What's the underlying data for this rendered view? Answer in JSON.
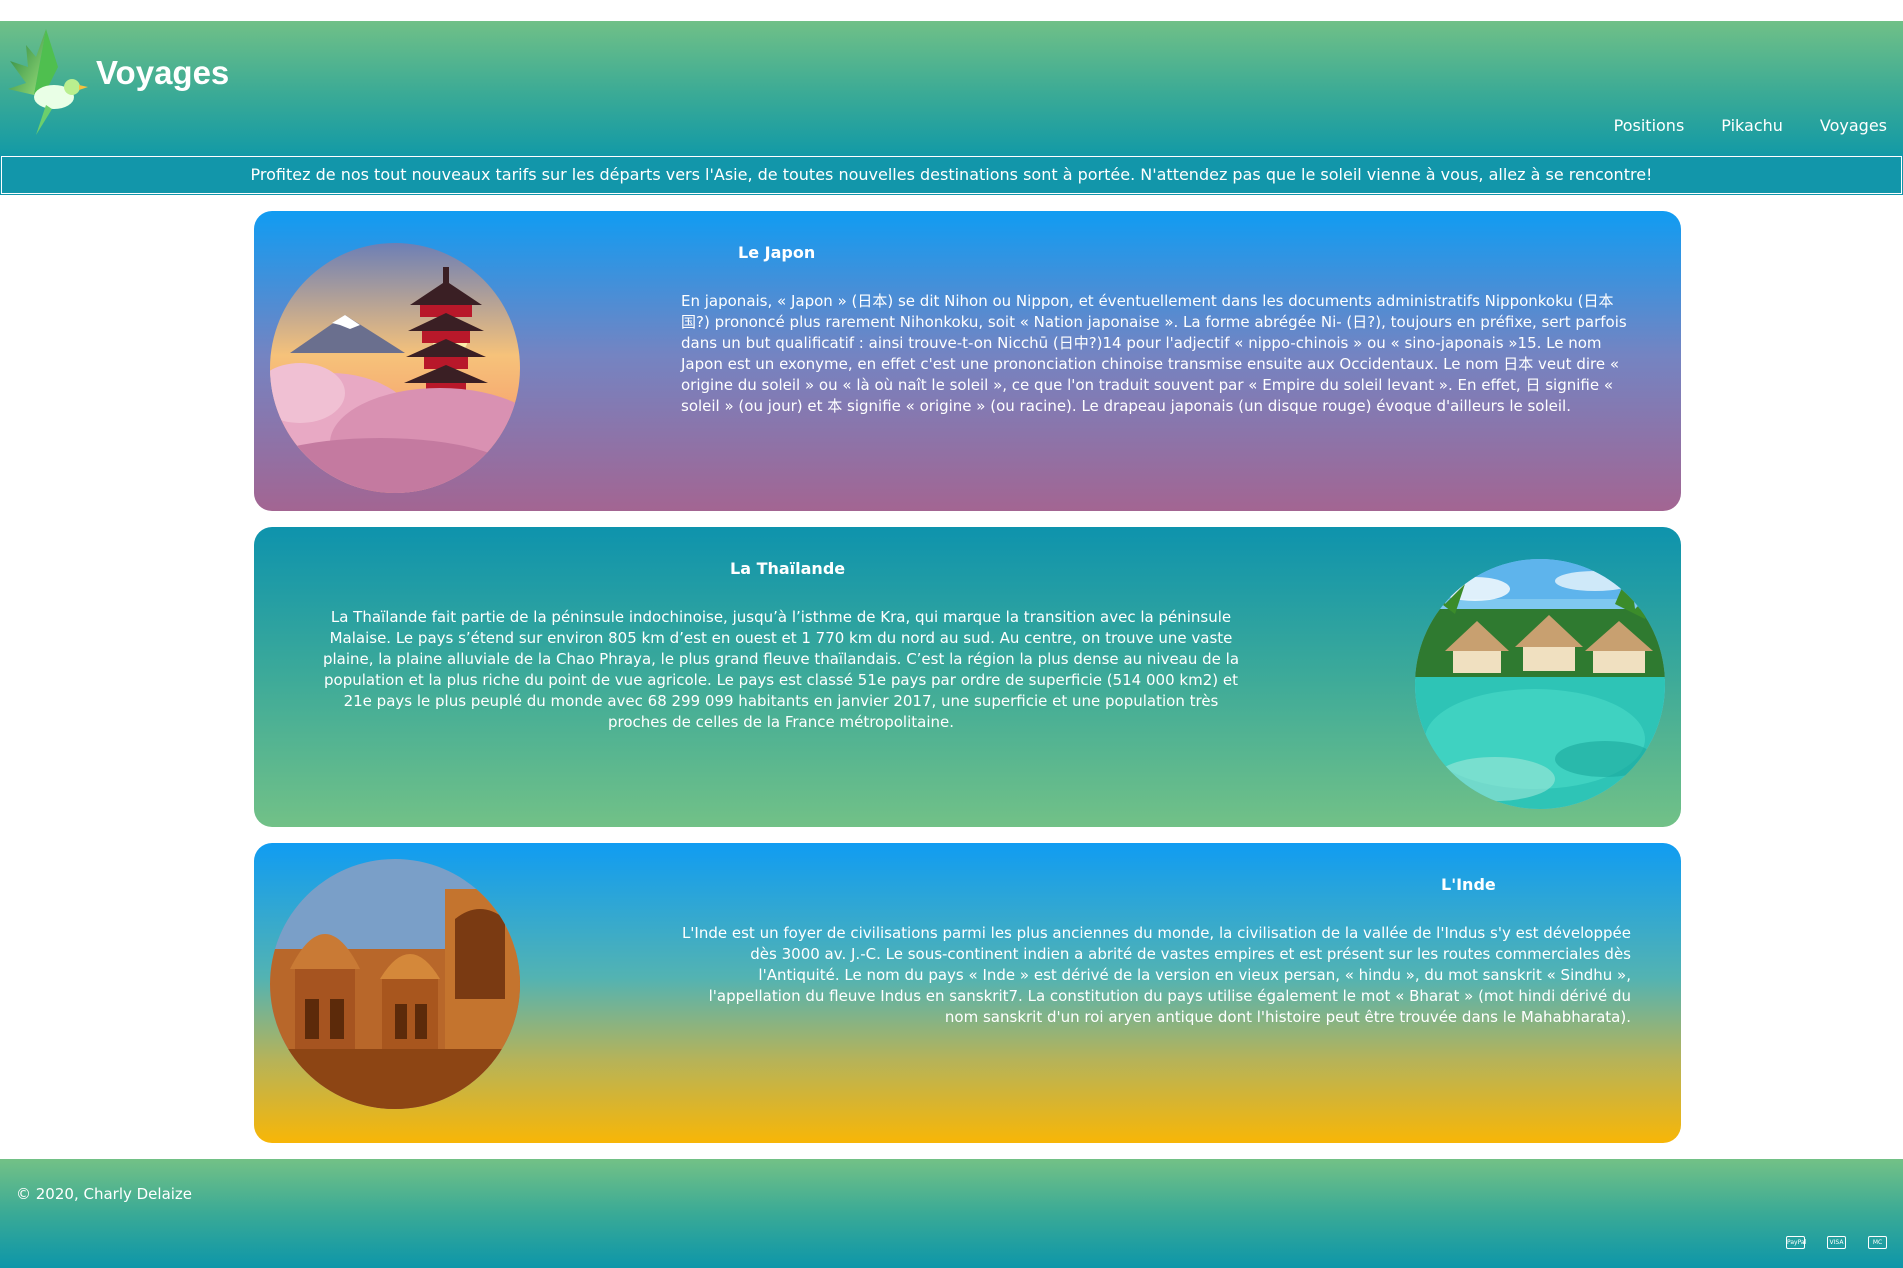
{
  "header": {
    "brand": "Voyages",
    "nav": [
      "Positions",
      "Pikachu",
      "Voyages"
    ]
  },
  "banner": "Profitez de nos tout nouveaux tarifs sur les départs vers l'Asie, de toutes nouvelles destinations sont à portée. N'attendez pas que le soleil vienne à vous, allez à se rencontre!",
  "cards": [
    {
      "title": "Le Japon",
      "text": "En japonais, « Japon » (日本) se dit Nihon ou Nippon, et éventuellement dans les documents administratifs Nipponkoku (日本国?) prononcé plus rarement Nihonkoku, soit « Nation japonaise ». La forme abrégée Ni- (日?), toujours en préfixe, sert parfois dans un but qualificatif : ainsi trouve-t-on Nicchū (日中?)14 pour l'adjectif « nippo-chinois » ou « sino-japonais »15. Le nom Japon est un exonyme, en effet c'est une prononciation chinoise transmise ensuite aux Occidentaux. Le nom 日本 veut dire « origine du soleil » ou « là où naît le soleil », ce que l'on traduit souvent par « Empire du soleil levant ». En effet, 日 signifie « soleil » (ou jour) et 本 signifie « origine » (ou racine). Le drapeau japonais (un disque rouge) évoque d'ailleurs le soleil.",
      "colors": [
        "#109cf2",
        "#a36592"
      ]
    },
    {
      "title": "La Thaïlande",
      "text": "La Thaïlande fait partie de la péninsule indochinoise, jusqu’à l’isthme de Kra, qui marque la transition avec la péninsule Malaise. Le pays s’étend sur environ 805 km d’est en ouest et 1 770 km du nord au sud. Au centre, on trouve une vaste plaine, la plaine alluviale de la Chao Phraya, le plus grand fleuve thaïlandais. C’est la région la plus dense au niveau de la population et la plus riche du point de vue agricole. Le pays est classé 51e pays par ordre de superficie (514 000 km2) et 21e pays le plus peuplé du monde avec 68 299 099 habitants en janvier 2017, une superficie et une population très proches de celles de la France métropolitaine.",
      "colors": [
        "#0e93ad",
        "#72c187"
      ]
    },
    {
      "title": "L'Inde",
      "text": "L'Inde est un foyer de civilisations parmi les plus anciennes du monde, la civilisation de la vallée de l'Indus s'y est développée dès 3000 av. J.-C. Le sous-continent indien a abrité de vastes empires et est présent sur les routes commerciales dès l'Antiquité. Le nom du pays « Inde » est dérivé de la version en vieux persan, « hindu », du mot sanskrit « Sindhu », l'appellation du fleuve Indus en sanskrit7. La constitution du pays utilise également le mot « Bharat » (mot hindi dérivé du nom sanskrit d'un roi aryen antique dont l'histoire peut être trouvée dans le Mahabharata).",
      "colors": [
        "#109cf2",
        "#f8b607"
      ]
    }
  ],
  "footer": {
    "copyright": "© 2020, Charly Delaize",
    "payments": [
      "PayPal",
      "VISA",
      "MC"
    ]
  }
}
